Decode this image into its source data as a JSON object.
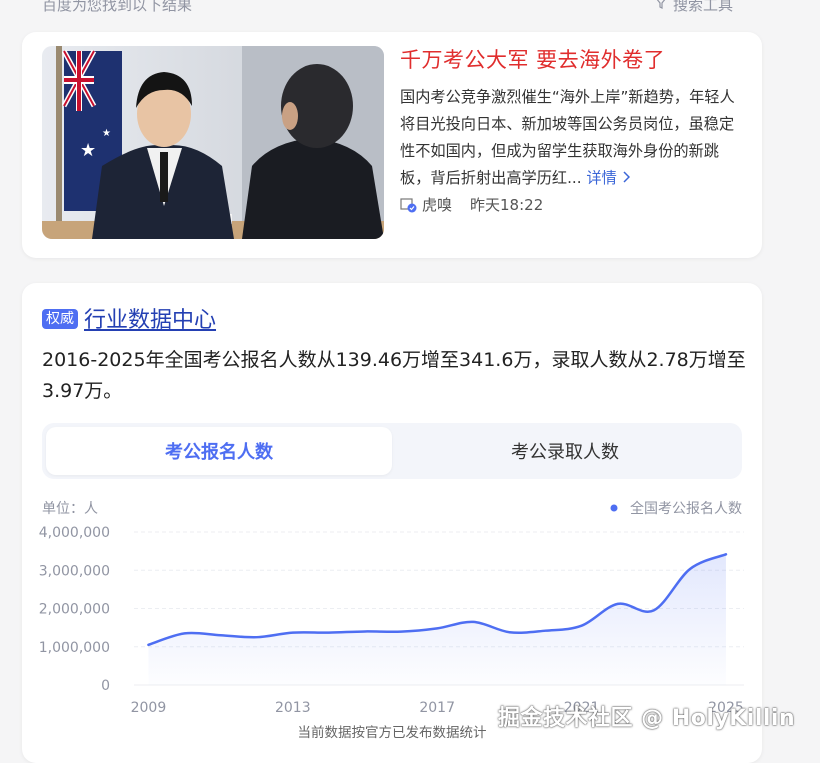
{
  "top_bar": {
    "found_text": "百度为您找到以下结果",
    "tools_label": "搜索工具"
  },
  "news_card": {
    "title": "千万考公大军 要去海外卷了",
    "body": "国内考公竞争激烈催生“海外上岸”新趋势，年轻人将目光投向日本、新加坡等国公务员岗位，虽稳定性不如国内，但成为留学生获取海外身份的新跳板，背后折射出高学历红...",
    "more_label": "详情",
    "source": "虎嗅",
    "time": "昨天18:22",
    "image_icon": "interview-photo"
  },
  "data_card": {
    "badge": "权威",
    "title": "行业数据中心",
    "summary": "2016-2025年全国考公报名人数从139.46万增至341.6万，录取人数从2.78万增至3.97万。",
    "tabs": [
      {
        "label": "考公报名人数",
        "active": true
      },
      {
        "label": "考公录取人数",
        "active": false
      }
    ],
    "footer_note": "当前数据按官方已发布数据统计"
  },
  "watermark": "掘金技术社区 @ HolyKillin",
  "chart_data": {
    "type": "area",
    "unit_label": "单位：人",
    "legend": [
      {
        "name": "全国考公报名人数",
        "color": "#4e6ef2"
      }
    ],
    "legend_position": "top-right",
    "y_ticks": [
      "4,000,000",
      "3,000,000",
      "2,000,000",
      "1,000,000",
      "0"
    ],
    "y_tick_values": [
      4000000,
      3000000,
      2000000,
      1000000,
      0
    ],
    "ylim": [
      0,
      4000000
    ],
    "x_ticks": [
      "2009",
      "2013",
      "2017",
      "2021",
      "2025"
    ],
    "x_tick_values": [
      2009,
      2013,
      2017,
      2021,
      2025
    ],
    "xlim": [
      2008.6,
      2025.5
    ],
    "grid": true,
    "series": [
      {
        "name": "全国考公报名人数",
        "x": [
          2009,
          2010,
          2011,
          2012,
          2013,
          2014,
          2015,
          2016,
          2017,
          2018,
          2019,
          2020,
          2021,
          2022,
          2023,
          2024,
          2025
        ],
        "values": [
          1050000,
          1350000,
          1300000,
          1250000,
          1370000,
          1370000,
          1400000,
          1394600,
          1480000,
          1650000,
          1380000,
          1420000,
          1550000,
          2120000,
          1950000,
          3030000,
          3416000
        ]
      }
    ]
  }
}
